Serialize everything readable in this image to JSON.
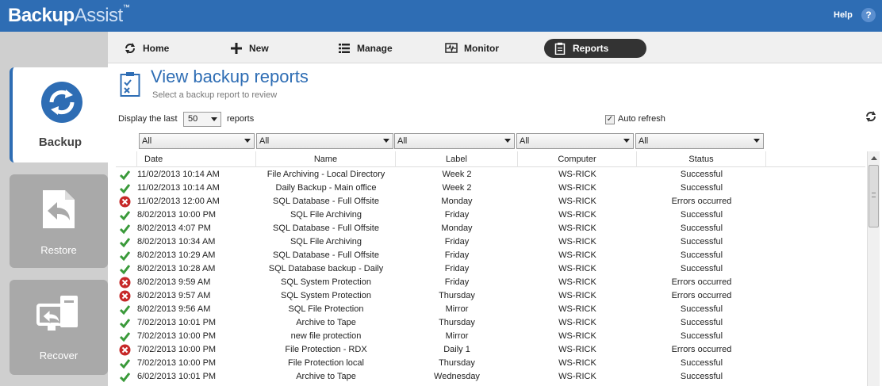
{
  "app": {
    "logo_bold": "Backup",
    "logo_light": "Assist",
    "logo_tm": "™",
    "help": "Help",
    "help_icon": "?"
  },
  "sidebar": {
    "backup": "Backup",
    "restore": "Restore",
    "recover": "Recover"
  },
  "nav": {
    "home": "Home",
    "new": "New",
    "manage": "Manage",
    "monitor": "Monitor",
    "reports": "Reports"
  },
  "page": {
    "title": "View backup reports",
    "subtitle": "Select a backup report to review"
  },
  "controls": {
    "display_label": "Display the last",
    "count": "50",
    "reports_label": "reports",
    "auto_refresh": "Auto refresh",
    "auto_refresh_checked": true
  },
  "filters": [
    "All",
    "All",
    "All",
    "All",
    "All"
  ],
  "columns": [
    "Date",
    "Name",
    "Label",
    "Computer",
    "Status"
  ],
  "rows": [
    {
      "ok": true,
      "date": "11/02/2013 10:14 AM",
      "name": "File Archiving - Local Directory",
      "label": "Week 2",
      "computer": "WS-RICK",
      "status": "Successful"
    },
    {
      "ok": true,
      "date": "11/02/2013 10:14 AM",
      "name": "Daily Backup - Main office",
      "label": "Week 2",
      "computer": "WS-RICK",
      "status": "Successful"
    },
    {
      "ok": false,
      "date": "11/02/2013 12:00 AM",
      "name": "SQL Database - Full Offsite",
      "label": "Monday",
      "computer": "WS-RICK",
      "status": "Errors occurred"
    },
    {
      "ok": true,
      "date": "8/02/2013 10:00 PM",
      "name": "SQL File Archiving",
      "label": "Friday",
      "computer": "WS-RICK",
      "status": "Successful"
    },
    {
      "ok": true,
      "date": "8/02/2013 4:07 PM",
      "name": "SQL Database - Full Offsite",
      "label": "Monday",
      "computer": "WS-RICK",
      "status": "Successful"
    },
    {
      "ok": true,
      "date": "8/02/2013 10:34 AM",
      "name": "SQL File Archiving",
      "label": "Friday",
      "computer": "WS-RICK",
      "status": "Successful"
    },
    {
      "ok": true,
      "date": "8/02/2013 10:29 AM",
      "name": "SQL Database - Full Offsite",
      "label": "Friday",
      "computer": "WS-RICK",
      "status": "Successful"
    },
    {
      "ok": true,
      "date": "8/02/2013 10:28 AM",
      "name": "SQL Database backup - Daily",
      "label": "Friday",
      "computer": "WS-RICK",
      "status": "Successful"
    },
    {
      "ok": false,
      "date": "8/02/2013 9:59 AM",
      "name": "SQL System Protection",
      "label": "Friday",
      "computer": "WS-RICK",
      "status": "Errors occurred"
    },
    {
      "ok": false,
      "date": "8/02/2013 9:57 AM",
      "name": "SQL System Protection",
      "label": "Thursday",
      "computer": "WS-RICK",
      "status": "Errors occurred"
    },
    {
      "ok": true,
      "date": "8/02/2013 9:56 AM",
      "name": "SQL File Protection",
      "label": "Mirror",
      "computer": "WS-RICK",
      "status": "Successful"
    },
    {
      "ok": true,
      "date": "7/02/2013 10:01 PM",
      "name": "Archive to Tape",
      "label": "Thursday",
      "computer": "WS-RICK",
      "status": "Successful"
    },
    {
      "ok": true,
      "date": "7/02/2013 10:00 PM",
      "name": "new file protection",
      "label": "Mirror",
      "computer": "WS-RICK",
      "status": "Successful"
    },
    {
      "ok": false,
      "date": "7/02/2013 10:00 PM",
      "name": "File Protection - RDX",
      "label": "Daily 1",
      "computer": "WS-RICK",
      "status": "Errors occurred"
    },
    {
      "ok": true,
      "date": "7/02/2013 10:00 PM",
      "name": "File Protection local",
      "label": "Thursday",
      "computer": "WS-RICK",
      "status": "Successful"
    },
    {
      "ok": true,
      "date": "6/02/2013 10:01 PM",
      "name": "Archive to Tape",
      "label": "Wednesday",
      "computer": "WS-RICK",
      "status": "Successful"
    }
  ],
  "colors": {
    "brand": "#2e6db4",
    "success": "#3a9a3a",
    "error": "#c62828"
  }
}
